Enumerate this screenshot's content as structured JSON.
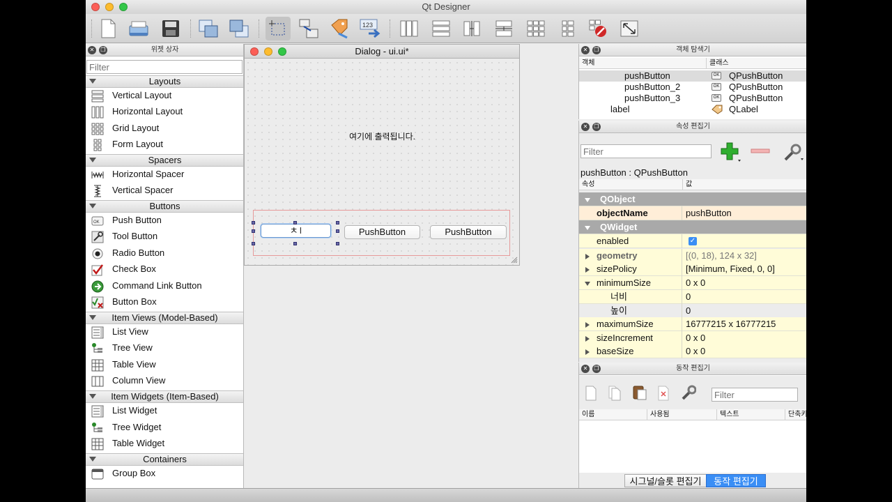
{
  "window": {
    "title": "Qt Designer"
  },
  "toolbar": {
    "icons": [
      "new-form-icon",
      "open-form-icon",
      "save-form-icon",
      "send-to-back-icon",
      "bring-to-front-icon",
      "edit-widgets-icon",
      "edit-signals-slots-icon",
      "edit-buddies-icon",
      "edit-tab-order-icon",
      "layout-horizontal-icon",
      "layout-vertical-icon",
      "layout-h-splitter-icon",
      "layout-v-splitter-icon",
      "layout-grid-icon",
      "layout-form-icon",
      "break-layout-icon",
      "adjust-size-icon"
    ]
  },
  "widget_box": {
    "title": "위젯 상자",
    "filter_placeholder": "Filter",
    "categories": {
      "layouts": "Layouts",
      "spacers": "Spacers",
      "buttons": "Buttons",
      "item_views": "Item Views (Model-Based)",
      "item_widgets": "Item Widgets (Item-Based)",
      "containers": "Containers"
    },
    "items": {
      "vertical_layout": "Vertical Layout",
      "horizontal_layout": "Horizontal Layout",
      "grid_layout": "Grid Layout",
      "form_layout": "Form Layout",
      "horizontal_spacer": "Horizontal Spacer",
      "vertical_spacer": "Vertical Spacer",
      "push_button": "Push Button",
      "tool_button": "Tool Button",
      "radio_button": "Radio Button",
      "check_box": "Check Box",
      "command_link_button": "Command Link Button",
      "button_box": "Button Box",
      "list_view": "List View",
      "tree_view": "Tree View",
      "table_view": "Table View",
      "column_view": "Column View",
      "list_widget": "List Widget",
      "tree_widget": "Tree Widget",
      "table_widget": "Table Widget",
      "group_box": "Group Box"
    }
  },
  "form": {
    "title": "Dialog - ui.ui*",
    "label_text": "여기에 출력됩니다.",
    "button1_editing_text": "ㅊ",
    "button2_text": "PushButton",
    "button3_text": "PushButton"
  },
  "object_inspector": {
    "title": "객체 탐색기",
    "col_object": "객체",
    "col_class": "클래스",
    "rows": [
      {
        "name": "pushButton",
        "class": "QPushButton"
      },
      {
        "name": "pushButton_2",
        "class": "QPushButton"
      },
      {
        "name": "pushButton_3",
        "class": "QPushButton"
      },
      {
        "name": "label",
        "class": "QLabel"
      }
    ]
  },
  "property_editor": {
    "title": "속성 편집기",
    "filter_placeholder": "Filter",
    "subject": "pushButton : QPushButton",
    "col_property": "속성",
    "col_value": "값",
    "group_qobject": "QObject",
    "group_qwidget": "QWidget",
    "props": {
      "object_name": {
        "name": "objectName",
        "value": "pushButton"
      },
      "enabled": {
        "name": "enabled",
        "checked": true
      },
      "geometry": {
        "name": "geometry",
        "value": "[(0, 18), 124 x 32]"
      },
      "size_policy": {
        "name": "sizePolicy",
        "value": "[Minimum, Fixed, 0, 0]"
      },
      "minimum_size": {
        "name": "minimumSize",
        "value": "0 x 0"
      },
      "min_width": {
        "name": "너비",
        "value": "0"
      },
      "min_height": {
        "name": "높이",
        "value": "0"
      },
      "maximum_size": {
        "name": "maximumSize",
        "value": "16777215 x 16777215"
      },
      "size_increment": {
        "name": "sizeIncrement",
        "value": "0 x 0"
      },
      "base_size": {
        "name": "baseSize",
        "value": "0 x 0"
      }
    }
  },
  "action_editor": {
    "title": "동작 편집기",
    "filter_placeholder": "Filter",
    "col_name": "이름",
    "col_used": "사용됨",
    "col_text": "텍스트",
    "col_shortcut": "단축키"
  },
  "bottom_tabs": {
    "signal_slot": "시그널/슬롯 편집기",
    "action": "동작 편집기"
  },
  "colors": {
    "accent": "#3a8ef5",
    "group_header": "#a9a9a9",
    "prop_yellow": "#fffcd8",
    "selected_row": "#dcdcdc"
  }
}
